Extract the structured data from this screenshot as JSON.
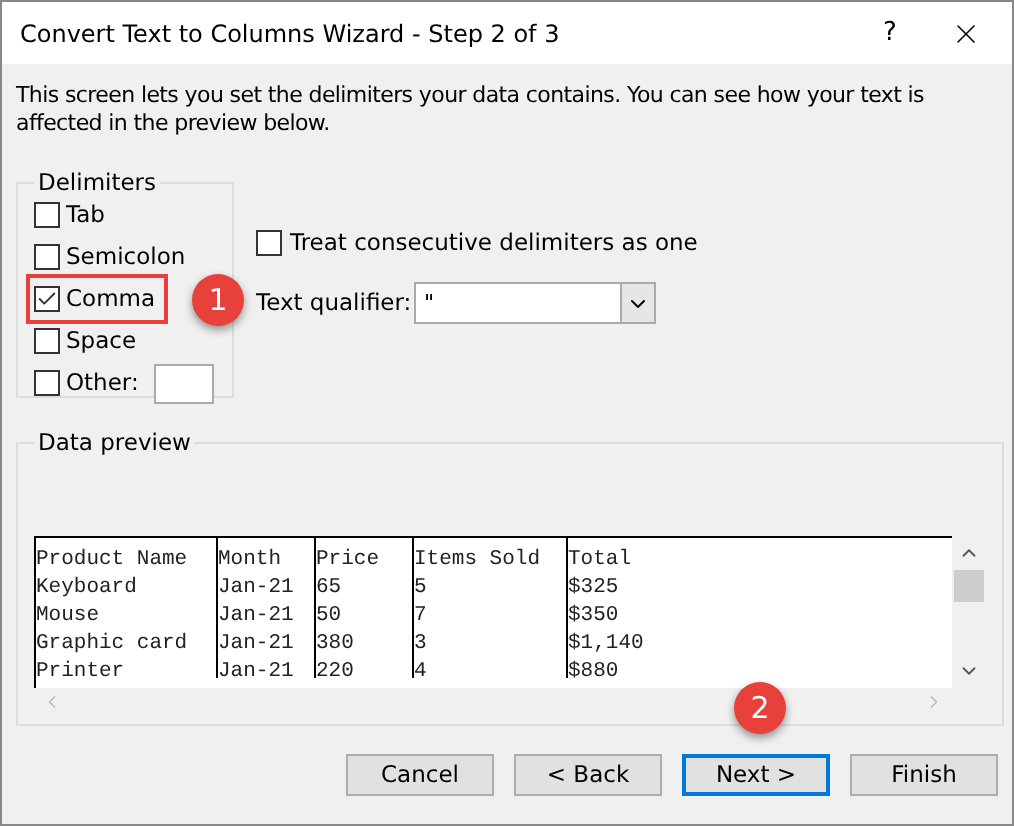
{
  "window": {
    "title": "Convert Text to Columns Wizard - Step 2 of 3",
    "help": "?"
  },
  "description": "This screen lets you set the delimiters your data contains.  You can see how your text is affected in the preview below.",
  "delimiters": {
    "title": "Delimiters",
    "items": [
      {
        "label": "Tab",
        "checked": false,
        "kind": "plain",
        "highlighted": false
      },
      {
        "label": "Semicolon",
        "checked": false,
        "kind": "plain",
        "highlighted": false
      },
      {
        "label": "Comma",
        "checked": true,
        "kind": "plain",
        "highlighted": true,
        "badge": "1"
      },
      {
        "label": "Space",
        "checked": false,
        "kind": "plain",
        "highlighted": false
      },
      {
        "label": "Other:",
        "checked": false,
        "kind": "with_field",
        "highlighted": false
      }
    ]
  },
  "treat_consecutive": {
    "label": "Treat consecutive delimiters as one",
    "checked": false
  },
  "text_qualifier": {
    "label": "Text qualifier:",
    "value": "\""
  },
  "data_preview": {
    "title": "Data preview",
    "rows": [
      [
        "Product Name",
        "Month",
        "Price",
        "Items Sold",
        "Total"
      ],
      [
        "Keyboard",
        "Jan-21",
        "65",
        "5",
        "$325"
      ],
      [
        "Mouse",
        "Jan-21",
        "50",
        "7",
        "$350"
      ],
      [
        "Graphic card",
        "Jan-21",
        "380",
        "3",
        "$1,140"
      ],
      [
        "Printer",
        "Jan-21",
        "220",
        "4",
        "$880"
      ]
    ]
  },
  "buttons": [
    {
      "label": "Cancel",
      "default": false
    },
    {
      "label": "< Back",
      "default": false
    },
    {
      "label": "Next >",
      "default": true,
      "badge": "2"
    },
    {
      "label": "Finish",
      "default": false
    }
  ]
}
